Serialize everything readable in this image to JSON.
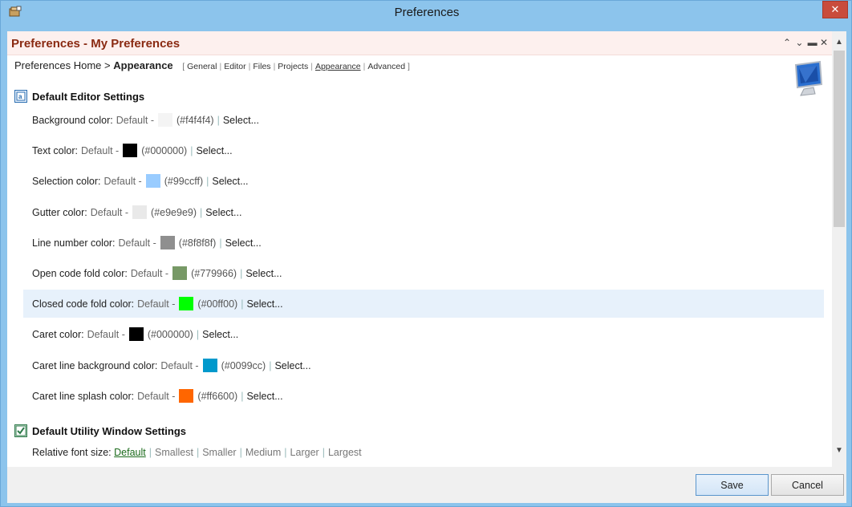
{
  "window": {
    "title": "Preferences"
  },
  "panel": {
    "title": "Preferences - My Preferences",
    "controls": [
      "^",
      "v",
      "=",
      "x"
    ]
  },
  "breadcrumb": {
    "home": "Preferences Home",
    "separator": ">",
    "current": "Appearance",
    "tabs": [
      "General",
      "Editor",
      "Files",
      "Projects",
      "Appearance",
      "Advanced"
    ],
    "active_tab": "Appearance"
  },
  "editor_section": {
    "title": "Default Editor Settings",
    "rows": [
      {
        "label": "Background color:",
        "default": "Default -",
        "hex": "(#f4f4f4)",
        "color": "#f4f4f4",
        "select": "Select..."
      },
      {
        "label": "Text color:",
        "default": "Default -",
        "hex": "(#000000)",
        "color": "#000000",
        "select": "Select..."
      },
      {
        "label": "Selection color:",
        "default": "Default -",
        "hex": "(#99ccff)",
        "color": "#99ccff",
        "select": "Select..."
      },
      {
        "label": "Gutter color:",
        "default": "Default -",
        "hex": "(#e9e9e9)",
        "color": "#e9e9e9",
        "select": "Select..."
      },
      {
        "label": "Line number color:",
        "default": "Default -",
        "hex": "(#8f8f8f)",
        "color": "#8f8f8f",
        "select": "Select..."
      },
      {
        "label": "Open code fold color:",
        "default": "Default -",
        "hex": "(#779966)",
        "color": "#779966",
        "select": "Select..."
      },
      {
        "label": "Closed code fold color:",
        "default": "Default -",
        "hex": "(#00ff00)",
        "color": "#00ff00",
        "select": "Select..."
      },
      {
        "label": "Caret color:",
        "default": "Default -",
        "hex": "(#000000)",
        "color": "#000000",
        "select": "Select..."
      },
      {
        "label": "Caret line background color:",
        "default": "Default -",
        "hex": "(#0099cc)",
        "color": "#0099cc",
        "select": "Select..."
      },
      {
        "label": "Caret line splash color:",
        "default": "Default -",
        "hex": "(#ff6600)",
        "color": "#ff6600",
        "select": "Select..."
      }
    ]
  },
  "utility_section": {
    "title": "Default Utility Window Settings",
    "font_label": "Relative font size:",
    "font_options": [
      "Default",
      "Smallest",
      "Smaller",
      "Medium",
      "Larger",
      "Largest"
    ],
    "font_selected": "Default"
  },
  "footer": {
    "save": "Save",
    "cancel": "Cancel"
  },
  "icons": {
    "app": "app-icon",
    "close": "close-icon",
    "monitor": "monitor-icon",
    "editor_section": "editor-settings-icon",
    "utility_section": "checkbox-icon"
  }
}
